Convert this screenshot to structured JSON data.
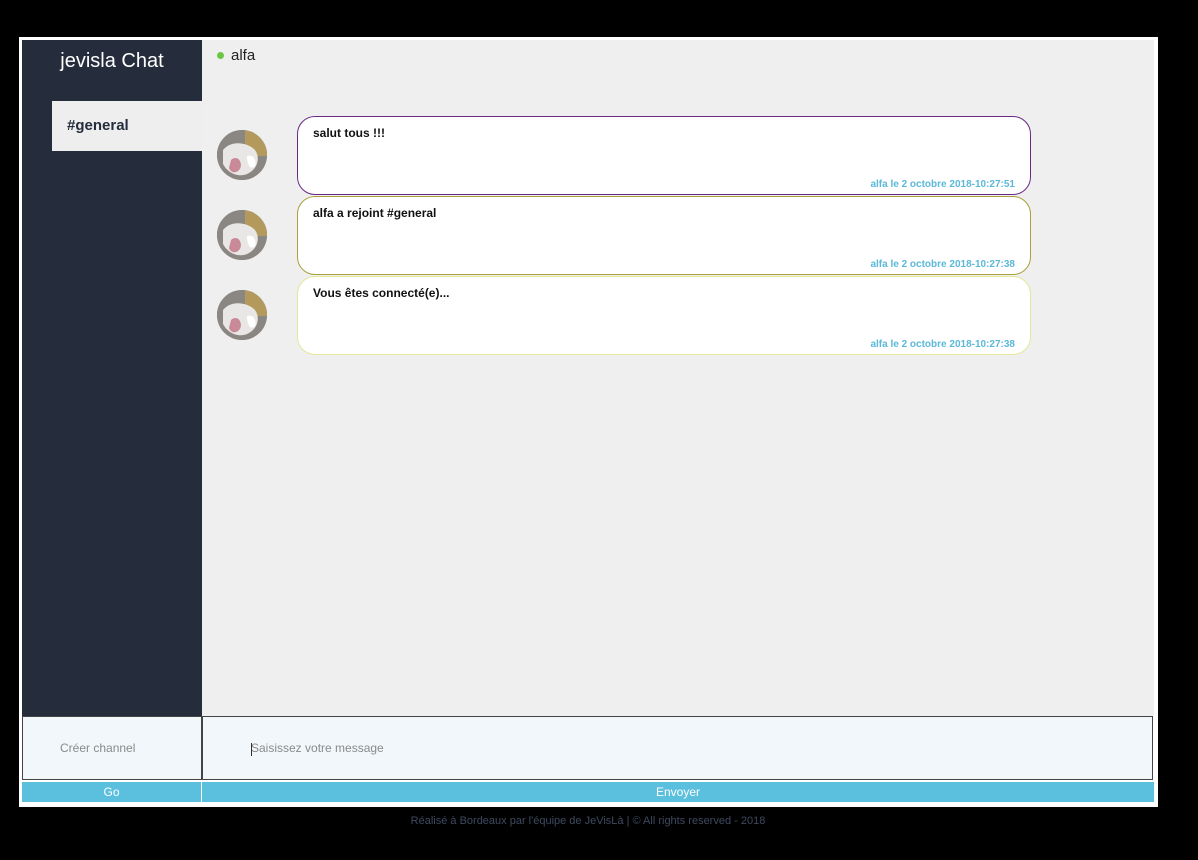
{
  "app": {
    "title": "jevisla Chat"
  },
  "sidebar": {
    "channels": [
      {
        "label": "#general"
      }
    ]
  },
  "header": {
    "online_user": "alfa",
    "online_status_color": "#6cc644"
  },
  "messages": [
    {
      "text": "salut tous !!!",
      "meta": "alfa le 2 octobre 2018-10:27:51",
      "border_color": "#6a2a84"
    },
    {
      "text": "alfa a rejoint #general",
      "meta": "alfa le 2 octobre 2018-10:27:38",
      "border_color": "#a9a03c"
    },
    {
      "text": "Vous êtes connecté(e)...",
      "meta": "alfa le 2 octobre 2018-10:27:38",
      "border_color": "#e5e79a"
    }
  ],
  "composer": {
    "channel_placeholder": "Créer channel",
    "channel_value": "",
    "message_placeholder": "Saisissez votre message",
    "message_value": "",
    "go_label": "Go",
    "send_label": "Envoyer"
  },
  "footer": {
    "text": "Réalisé à Bordeaux par l'équipe de JeVisLà | © All rights reserved - 2018"
  },
  "colors": {
    "sidebar_bg": "#252d3d",
    "main_bg": "#efefef",
    "accent": "#5bc0de",
    "meta_text": "#5bb8d8"
  }
}
